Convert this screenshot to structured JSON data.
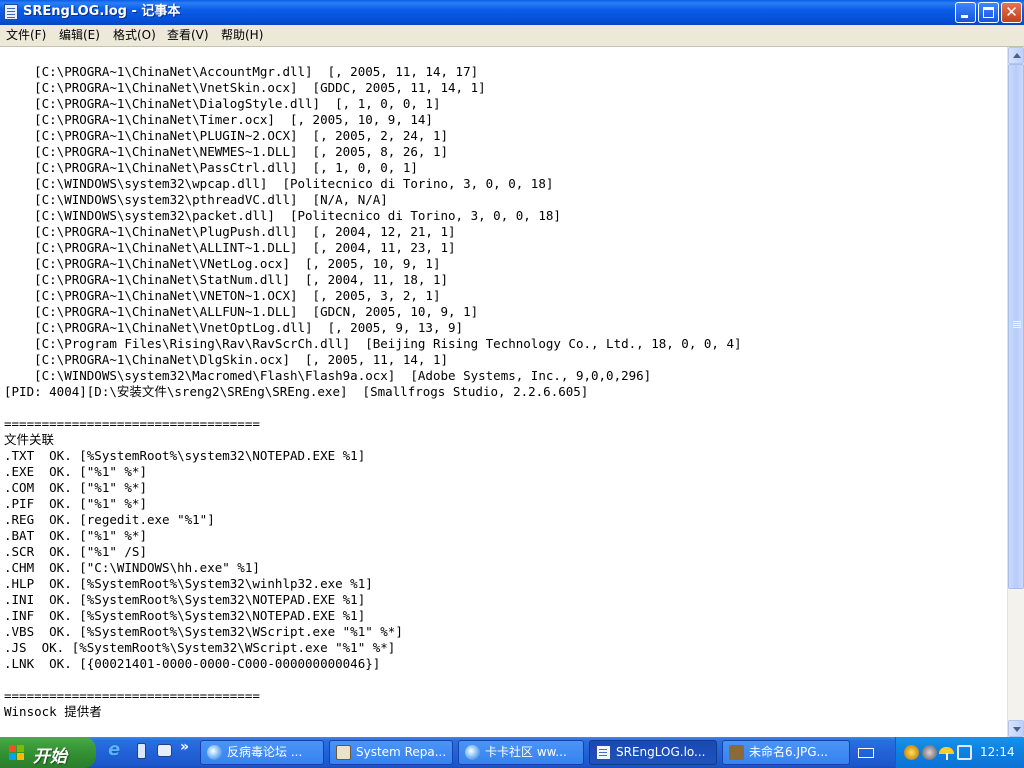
{
  "window": {
    "title": "SREngLOG.log - 记事本"
  },
  "menu": [
    {
      "label": "文件(F)"
    },
    {
      "label": "编辑(E)"
    },
    {
      "label": "格式(O)"
    },
    {
      "label": "查看(V)"
    },
    {
      "label": "帮助(H)"
    }
  ],
  "document": {
    "lines": [
      "    [C:\\PROGRA~1\\ChinaNet\\AccountMgr.dll]  [, 2005, 11, 14, 17]",
      "    [C:\\PROGRA~1\\ChinaNet\\VnetSkin.ocx]  [GDDC, 2005, 11, 14, 1]",
      "    [C:\\PROGRA~1\\ChinaNet\\DialogStyle.dll]  [, 1, 0, 0, 1]",
      "    [C:\\PROGRA~1\\ChinaNet\\Timer.ocx]  [, 2005, 10, 9, 14]",
      "    [C:\\PROGRA~1\\ChinaNet\\PLUGIN~2.OCX]  [, 2005, 2, 24, 1]",
      "    [C:\\PROGRA~1\\ChinaNet\\NEWMES~1.DLL]  [, 2005, 8, 26, 1]",
      "    [C:\\PROGRA~1\\ChinaNet\\PassCtrl.dll]  [, 1, 0, 0, 1]",
      "    [C:\\WINDOWS\\system32\\wpcap.dll]  [Politecnico di Torino, 3, 0, 0, 18]",
      "    [C:\\WINDOWS\\system32\\pthreadVC.dll]  [N/A, N/A]",
      "    [C:\\WINDOWS\\system32\\packet.dll]  [Politecnico di Torino, 3, 0, 0, 18]",
      "    [C:\\PROGRA~1\\ChinaNet\\PlugPush.dll]  [, 2004, 12, 21, 1]",
      "    [C:\\PROGRA~1\\ChinaNet\\ALLINT~1.DLL]  [, 2004, 11, 23, 1]",
      "    [C:\\PROGRA~1\\ChinaNet\\VNetLog.ocx]  [, 2005, 10, 9, 1]",
      "    [C:\\PROGRA~1\\ChinaNet\\StatNum.dll]  [, 2004, 11, 18, 1]",
      "    [C:\\PROGRA~1\\ChinaNet\\VNETON~1.OCX]  [, 2005, 3, 2, 1]",
      "    [C:\\PROGRA~1\\ChinaNet\\ALLFUN~1.DLL]  [GDCN, 2005, 10, 9, 1]",
      "    [C:\\PROGRA~1\\ChinaNet\\VnetOptLog.dll]  [, 2005, 9, 13, 9]",
      "    [C:\\Program Files\\Rising\\Rav\\RavScrCh.dll]  [Beijing Rising Technology Co., Ltd., 18, 0, 0, 4]",
      "    [C:\\PROGRA~1\\ChinaNet\\DlgSkin.ocx]  [, 2005, 11, 14, 1]",
      "    [C:\\WINDOWS\\system32\\Macromed\\Flash\\Flash9a.ocx]  [Adobe Systems, Inc., 9,0,0,296]",
      "[PID: 4004][D:\\安装文件\\sreng2\\SREng\\SREng.exe]  [Smallfrogs Studio, 2.2.6.605]",
      "",
      "==================================",
      "文件关联",
      ".TXT  OK. [%SystemRoot%\\system32\\NOTEPAD.EXE %1]",
      ".EXE  OK. [\"%1\" %*]",
      ".COM  OK. [\"%1\" %*]",
      ".PIF  OK. [\"%1\" %*]",
      ".REG  OK. [regedit.exe \"%1\"]",
      ".BAT  OK. [\"%1\" %*]",
      ".SCR  OK. [\"%1\" /S]",
      ".CHM  OK. [\"C:\\WINDOWS\\hh.exe\" %1]",
      ".HLP  OK. [%SystemRoot%\\System32\\winhlp32.exe %1]",
      ".INI  OK. [%SystemRoot%\\System32\\NOTEPAD.EXE %1]",
      ".INF  OK. [%SystemRoot%\\System32\\NOTEPAD.EXE %1]",
      ".VBS  OK. [%SystemRoot%\\System32\\WScript.exe \"%1\" %*]",
      ".JS  OK. [%SystemRoot%\\System32\\WScript.exe \"%1\" %*]",
      ".LNK  OK. [{00021401-0000-0000-C000-000000000046}]",
      "",
      "==================================",
      "Winsock 提供者"
    ]
  },
  "taskbar": {
    "start_label": "开始",
    "quick_launch": [
      {
        "icon": "internet-explorer-icon"
      },
      {
        "icon": "media-player-icon"
      },
      {
        "icon": "show-desktop-icon"
      },
      {
        "label": "»"
      }
    ],
    "tasks": [
      {
        "label": "反病毒论坛 ...",
        "icon": "web-page-icon",
        "active": false
      },
      {
        "label": "System Repa...",
        "icon": "tool-app-icon",
        "active": false
      },
      {
        "label": "卡卡社区 ww...",
        "icon": "web-page-icon",
        "active": false
      },
      {
        "label": "SREngLOG.lo...",
        "icon": "notepad-icon",
        "active": true
      },
      {
        "label": "未命名6.JPG...",
        "icon": "image-viewer-icon",
        "active": false
      }
    ],
    "tray": {
      "clock": "12:14",
      "icons": [
        "antivirus-tray-icon",
        "speaker-tray-icon",
        "umbrella-tray-icon",
        "network-tray-icon"
      ]
    }
  }
}
